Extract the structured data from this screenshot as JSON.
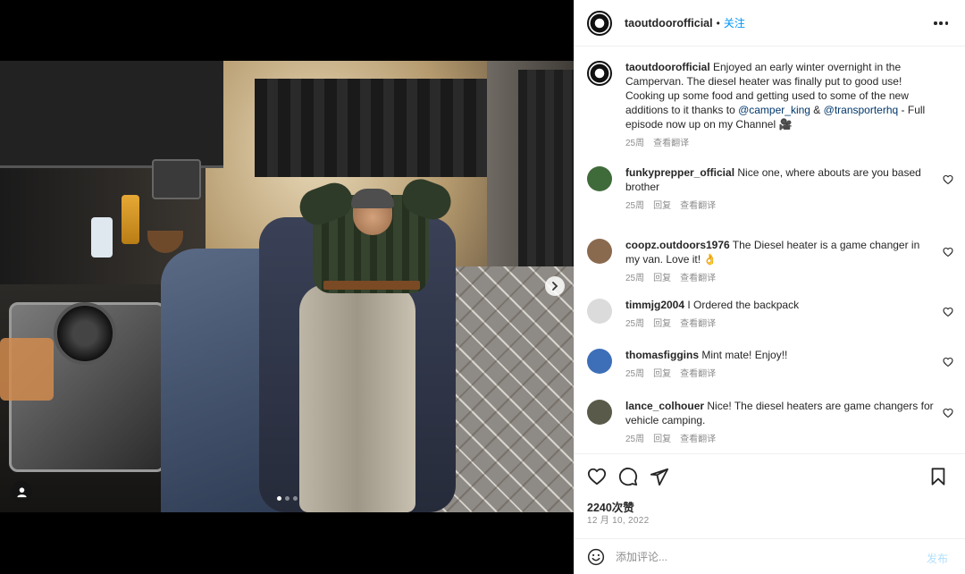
{
  "post": {
    "author": "taoutdoorofficial",
    "separator": "•",
    "follow_label": "关注",
    "more_icon": "more-horizontal-icon",
    "carousel": {
      "total_slides": 3,
      "active_slide": 1
    }
  },
  "caption": {
    "username": "taoutdoorofficial",
    "text_before": " Enjoyed an early winter overnight in the Campervan. The diesel heater was finally put to good use! Cooking up some food and getting used to some of the new additions to it thanks to ",
    "mention1": "@camper_king",
    "text_mid": " & ",
    "mention2": "@transporterhq",
    "text_after": " - Full episode now up on my Channel 🎥",
    "time": "25周",
    "translate": "查看翻译"
  },
  "comments": [
    {
      "username": "funkyprepper_official",
      "text": " Nice one, where abouts are you based brother",
      "time": "25周",
      "reply": "回复",
      "translate": "查看翻译",
      "avatar_color": "#3f6b3a"
    },
    {
      "username": "coopz.outdoors1976",
      "text": " The Diesel heater is a game changer in my van. Love it! 👌",
      "time": "25周",
      "reply": "回复",
      "translate": "查看翻译",
      "avatar_color": "#8a6a4e"
    },
    {
      "username": "timmjg2004",
      "text": " I Ordered the backpack",
      "time": "25周",
      "reply": "回复",
      "translate": "查看翻译",
      "avatar_color": "#dbdbdb"
    },
    {
      "username": "thomasfiggins",
      "text": " Mint mate! Enjoy!!",
      "time": "25周",
      "reply": "回复",
      "translate": "查看翻译",
      "avatar_color": "#3d6fb8"
    },
    {
      "username": "lance_colhouer",
      "text": " Nice! The diesel heaters are game changers for vehicle camping.",
      "time": "25周",
      "reply": "回复",
      "translate": "查看翻译",
      "avatar_color": "#5a5a4a"
    }
  ],
  "actions": {
    "likes": "2240次赞",
    "date": "12 月 10, 2022",
    "comment_placeholder": "添加评论...",
    "post_label": "发布"
  }
}
